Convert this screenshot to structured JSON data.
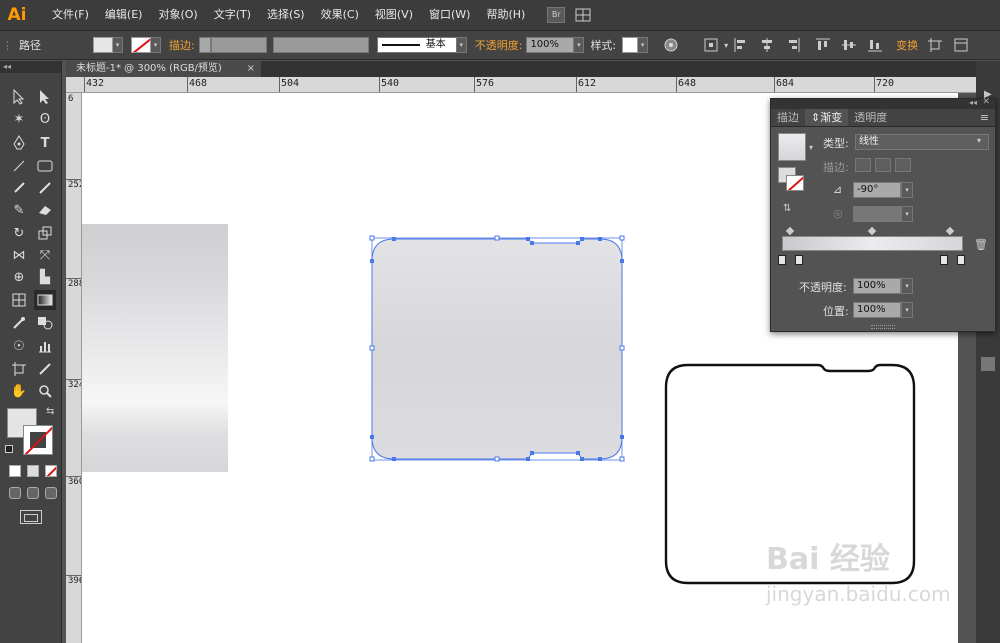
{
  "app": {
    "logo": "Ai"
  },
  "menubar": {
    "items": [
      "文件(F)",
      "编辑(E)",
      "对象(O)",
      "文字(T)",
      "选择(S)",
      "效果(C)",
      "视图(V)",
      "窗口(W)",
      "帮助(H)"
    ],
    "bridge_label": "Br"
  },
  "controlbar": {
    "selection_label": "路径",
    "stroke_label": "描边:",
    "brush_label": "基本",
    "opacity_label": "不透明度:",
    "opacity_value": "100%",
    "style_label": "样式:",
    "transform_label": "变换"
  },
  "document": {
    "tab_title": "未标题-1* @ 300% (RGB/预览)",
    "close_glyph": "×"
  },
  "rulers": {
    "horizontal": [
      "432",
      "468",
      "504",
      "540",
      "576",
      "612",
      "648",
      "684",
      "720"
    ],
    "vertical": [
      "252",
      "288",
      "324",
      "360",
      "396"
    ],
    "vertical_partial_top": "6"
  },
  "gradient_panel": {
    "tabs": [
      "描边",
      "渐变",
      "透明度"
    ],
    "active_tab": "渐变",
    "type_label": "类型:",
    "type_value": "线性",
    "stroke_label": "描边:",
    "angle_value": "-90°",
    "opacity_label": "不透明度:",
    "opacity_value": "100%",
    "location_label": "位置:",
    "location_value": "100%",
    "gradient_colors": [
      "#c9c9cc",
      "#ececee",
      "#d6d6d9"
    ]
  },
  "watermark": {
    "brand": "Bai 经验",
    "url": "jingyan.baidu.com"
  },
  "colors": {
    "accent_orange": "#ff9a00",
    "selection_blue": "#4a78e8",
    "no_stroke_red": "#e01010"
  }
}
